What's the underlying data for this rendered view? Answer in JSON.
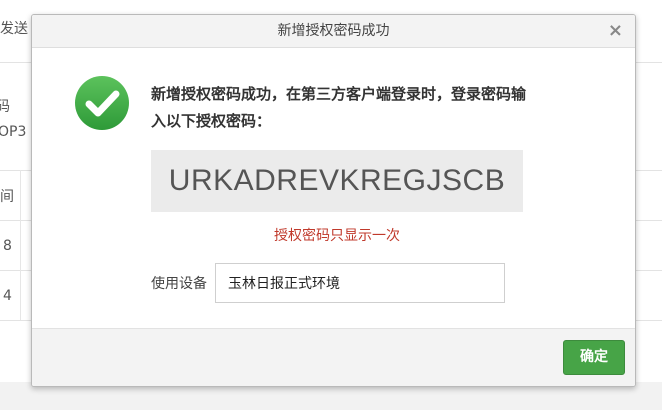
{
  "background": {
    "header_fragment": "发送",
    "left_fragments": [
      "码",
      "OP3",
      "间",
      "8",
      "4"
    ]
  },
  "dialog": {
    "title": "新增授权密码成功",
    "close_glyph": "×",
    "icon": "check-circle-icon",
    "message": "新增授权密码成功，在第三方客户端登录时，登录密码输入以下授权密码：",
    "auth_code": "URKADREVKREGJSCB",
    "note": "授权密码只显示一次",
    "device_label": "使用设备",
    "device_value": "玉林日报正式环境",
    "confirm_label": "确定"
  },
  "colors": {
    "accent_green": "#47a447",
    "note_red": "#c0392b",
    "icon_green": "#3da845"
  }
}
